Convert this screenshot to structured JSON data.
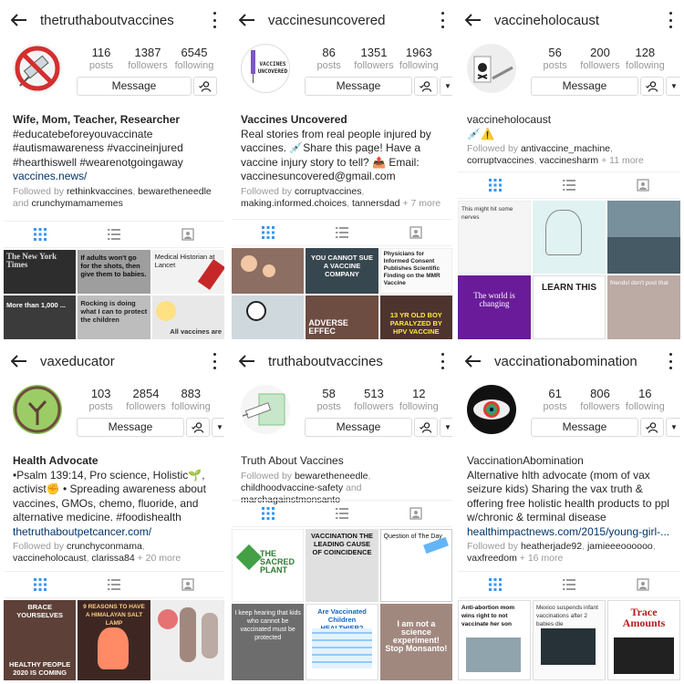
{
  "profiles": [
    {
      "username": "thetruthaboutvaccines",
      "posts": "116",
      "followers": "1387",
      "following": "6545",
      "labels": {
        "posts": "posts",
        "followers": "followers",
        "following": "following"
      },
      "message_label": "Message",
      "bio_name": "Wife, Mom, Teacher, Researcher",
      "bio_text": "#educatebeforeyouvaccinate\n#autismawareness #vaccineinjured\n#hearthiswell #wearenotgoingaway",
      "bio_link": "vaccines.news/",
      "followed_by_prefix": "Followed by",
      "followed_by": [
        "rethinkvaccines",
        "bewaretheneedle",
        "crunchymamamemes"
      ],
      "followed_by_joiner": "and",
      "followed_more": "",
      "thumbs": [
        "The New York Times",
        "If adults won't go for the shots, then give them to babies.",
        "Medical Historian at Lancet",
        "More than 1,000 ...",
        "Rocking is doing what I can to protect the children",
        "All vaccines are"
      ],
      "avatar_icon": "no-vaccine-sign-icon"
    },
    {
      "username": "vaccinesuncovered",
      "posts": "86",
      "followers": "1351",
      "following": "1963",
      "labels": {
        "posts": "posts",
        "followers": "followers",
        "following": "following"
      },
      "message_label": "Message",
      "bio_name": "Vaccines Uncovered",
      "bio_text": "Real stories from real people injured by vaccines. 💉Share this page! Have a vaccine injury story to tell? 📤 Email: vaccinesuncovered@gmail.com",
      "bio_link": "",
      "followed_by_prefix": "Followed by",
      "followed_by": [
        "corruptvaccines",
        "making.informed.choices",
        "tannersdad"
      ],
      "followed_by_joiner": "",
      "followed_more": "+ 7 more",
      "avatar_text": "VACCINES UNCOVERED",
      "thumbs": [
        "",
        "YOU CANNOT SUE A VACCINE COMPANY",
        "Physicians for Informed Consent Publishes Scientific Finding on the MMR Vaccine",
        "",
        "ADVERSE EFFEC",
        "13 YR OLD BOY PARALYZED BY HPV VACCINE"
      ]
    },
    {
      "username": "vaccineholocaust",
      "posts": "56",
      "followers": "200",
      "following": "128",
      "labels": {
        "posts": "posts",
        "followers": "followers",
        "following": "following"
      },
      "message_label": "Message",
      "bio_name": "vaccineholocaust",
      "bio_text": "💉⚠️",
      "bio_link": "",
      "followed_by_prefix": "Followed by",
      "followed_by": [
        "antivaccine_machine",
        "corruptvaccines",
        "vaccinesharm"
      ],
      "followed_by_joiner": "",
      "followed_more": "+ 11 more",
      "thumbs": [
        "This might hit some nerves",
        "",
        "",
        "The world is changing",
        "LEARN THIS",
        "friends! don't post that"
      ]
    },
    {
      "username": "vaxeducator",
      "posts": "103",
      "followers": "2854",
      "following": "883",
      "labels": {
        "posts": "posts",
        "followers": "followers",
        "following": "following"
      },
      "message_label": "Message",
      "bio_name": "Health Advocate",
      "bio_text": "•Psalm 139:14, Pro science, Holistic🌱, activist✊ • Spreading awareness about vaccines, GMOs, chemo, fluoride, and alternative medicine. #foodishealth",
      "bio_link": "thetruthaboutpetcancer.com/",
      "followed_by_prefix": "Followed by",
      "followed_by": [
        "crunchyconmama",
        "vaccineholocaust",
        "clarissa84"
      ],
      "followed_by_joiner": "",
      "followed_more": "+ 20 more",
      "thumbs": [
        "BRACE YOURSELVES",
        "9 REASONS TO HAVE A HIMALAYAN SALT LAMP",
        "",
        "HEALTHY PEOPLE 2020 IS COMING"
      ]
    },
    {
      "username": "truthaboutvaccines",
      "posts": "58",
      "followers": "513",
      "following": "12",
      "labels": {
        "posts": "posts",
        "followers": "followers",
        "following": "following"
      },
      "message_label": "Message",
      "bio_name": "Truth About Vaccines",
      "bio_text": "",
      "bio_link": "",
      "followed_by_prefix": "Followed by",
      "followed_by": [
        "bewaretheneedle",
        "childhoodvaccine-safety",
        "marchagainstmonsanto"
      ],
      "followed_by_joiner": "and",
      "followed_more": "",
      "thumbs": [
        "THE SACRED PLANT",
        "VACCINATION THE LEADING CAUSE OF COINCIDENCE",
        "Question of The Day",
        "I keep hearing that kids who cannot be vaccinated must be protected",
        "Are Vaccinated Children HEALTHIER?",
        "I am not a science experiment! Stop Monsanto!"
      ]
    },
    {
      "username": "vaccinationabomination",
      "posts": "61",
      "followers": "806",
      "following": "16",
      "labels": {
        "posts": "posts",
        "followers": "followers",
        "following": "following"
      },
      "message_label": "Message",
      "bio_name": "VaccinationAbomination",
      "bio_text": "Alternative hlth advocate (mom of vax seizure kids) Sharing the vax truth & offering free holistic health products to ppl w/chronic & terminal disease",
      "bio_link": "healthimpactnews.com/2015/young-girl-...",
      "followed_by_prefix": "Followed by",
      "followed_by": [
        "heatherjade92",
        "jamieeeoooooo",
        "vaxfreedom"
      ],
      "followed_by_joiner": "",
      "followed_more": "+ 16 more",
      "thumbs": [
        "Anti-abortion mom wins right to not vaccinate her son",
        "Mexico suspends infant vaccinations after 2 babies die",
        "Trace Amounts"
      ]
    }
  ],
  "colors": {
    "link": "#003569",
    "muted": "#999999",
    "border": "#dbdbdb"
  }
}
